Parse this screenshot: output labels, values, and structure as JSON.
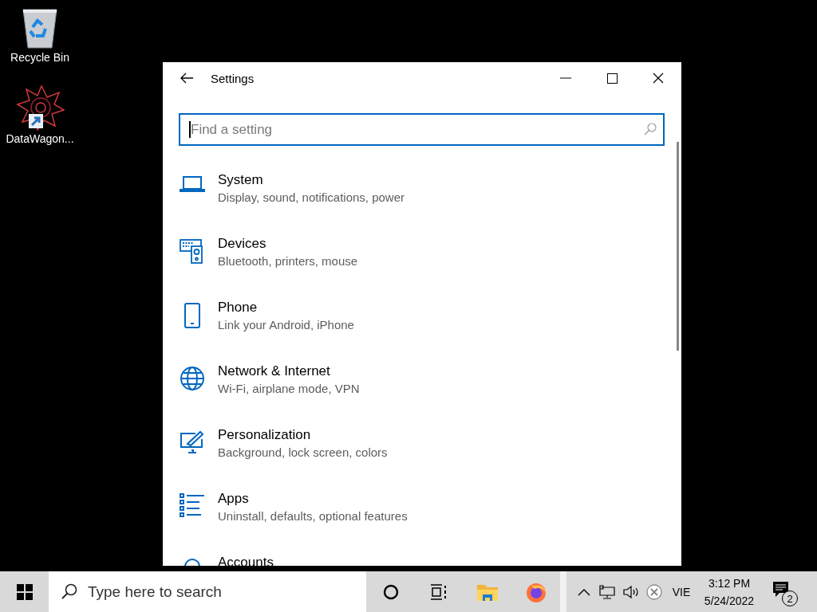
{
  "desktop_icons": [
    {
      "kind": "recycle-bin",
      "label": "Recycle Bin"
    },
    {
      "kind": "shortcut",
      "label": "DataWagon..."
    }
  ],
  "window": {
    "title": "Settings",
    "search": {
      "placeholder": "Find a setting"
    },
    "categories": [
      {
        "kind": "system",
        "title": "System",
        "subtitle": "Display, sound, notifications, power"
      },
      {
        "kind": "devices",
        "title": "Devices",
        "subtitle": "Bluetooth, printers, mouse"
      },
      {
        "kind": "phone",
        "title": "Phone",
        "subtitle": "Link your Android, iPhone"
      },
      {
        "kind": "network",
        "title": "Network & Internet",
        "subtitle": "Wi-Fi, airplane mode, VPN"
      },
      {
        "kind": "personalization",
        "title": "Personalization",
        "subtitle": "Background, lock screen, colors"
      },
      {
        "kind": "apps",
        "title": "Apps",
        "subtitle": "Uninstall, defaults, optional features"
      },
      {
        "kind": "accounts",
        "title": "Accounts"
      }
    ]
  },
  "taskbar": {
    "search": {
      "placeholder": "Type here to search"
    },
    "language": "VIE",
    "time": "3:12 PM",
    "date": "5/24/2022",
    "notification_count": "2"
  }
}
